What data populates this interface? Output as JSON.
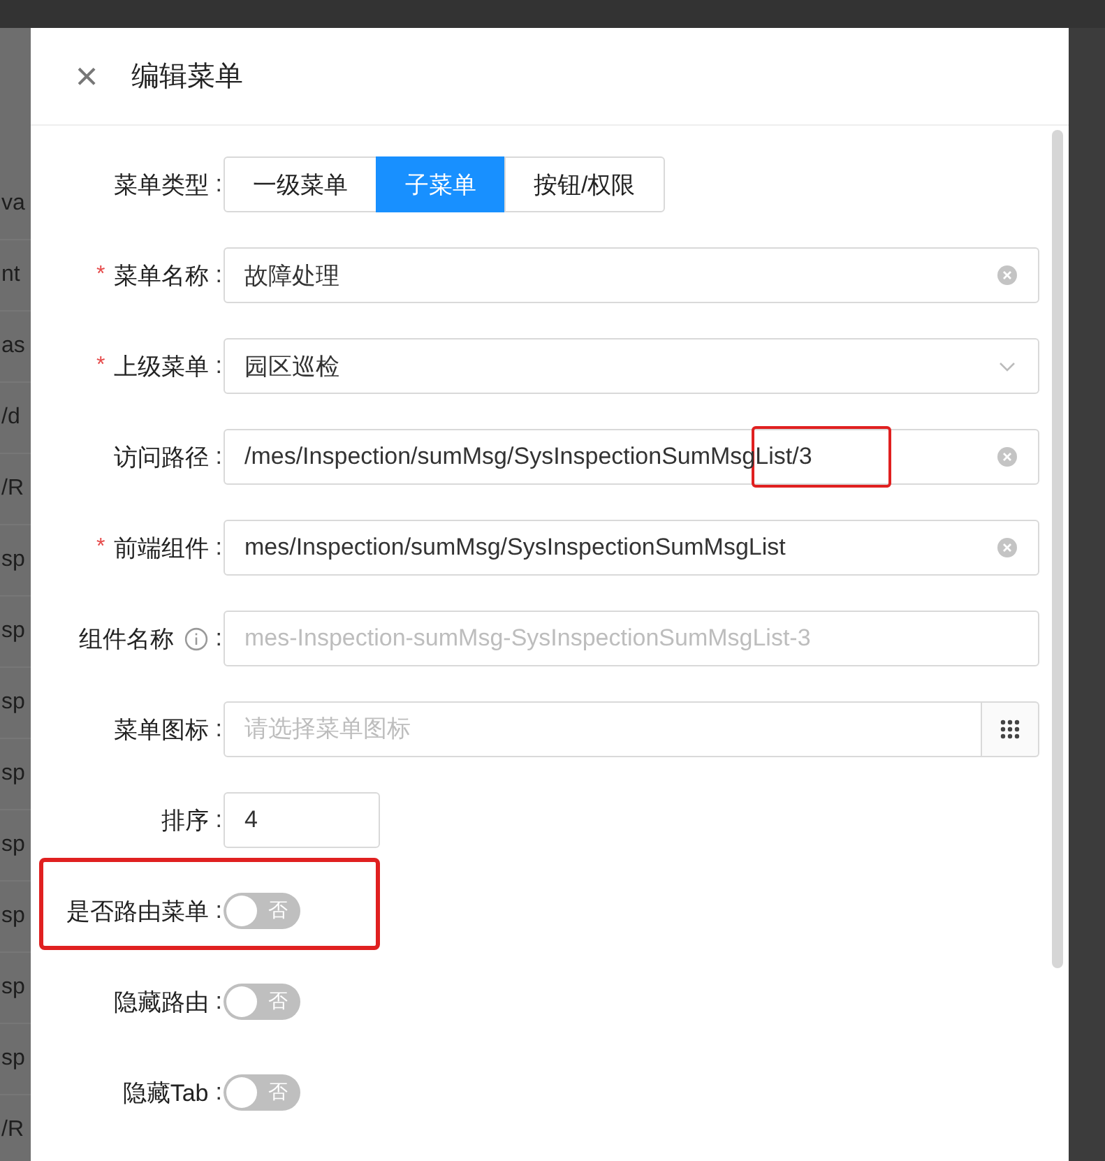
{
  "background_fragments": [
    "va",
    "nt",
    "as",
    "/d",
    "/R",
    "sp",
    "sp",
    "sp",
    "sp",
    "sp",
    "sp",
    "sp",
    "sp",
    "/R"
  ],
  "drawer": {
    "close": "×",
    "title": "编辑菜单"
  },
  "form": [
    {
      "kind": "segmented",
      "label": "菜单类型",
      "colon": ":",
      "options": [
        {
          "label": "一级菜单",
          "selected": false
        },
        {
          "label": "子菜单",
          "selected": true
        },
        {
          "label": "按钮/权限",
          "selected": false
        }
      ]
    },
    {
      "kind": "input",
      "required_mark": "*",
      "label": "菜单名称",
      "colon": ":",
      "value": "故障处理"
    },
    {
      "kind": "select",
      "required_mark": "*",
      "label": "上级菜单",
      "colon": ":",
      "value": "园区巡检"
    },
    {
      "kind": "input",
      "label": "访问路径",
      "colon": ":",
      "value": "/mes/Inspection/sumMsg/SysInspectionSumMsgList/3",
      "marked": true
    },
    {
      "kind": "input",
      "required_mark": "*",
      "label": "前端组件",
      "colon": ":",
      "value": "mes/Inspection/sumMsg/SysInspectionSumMsgList"
    },
    {
      "kind": "hint",
      "label": "组件名称",
      "colon": ":",
      "placeholder": "mes-Inspection-sumMsg-SysInspectionSumMsgList-3"
    },
    {
      "kind": "icon",
      "label": "菜单图标",
      "colon": ":",
      "placeholder": "请选择菜单图标"
    },
    {
      "kind": "number",
      "label": "排序",
      "colon": ":",
      "value": "4"
    },
    {
      "kind": "switch",
      "label": "是否路由菜单",
      "colon": ":",
      "on": false,
      "text": "否",
      "marked": true
    },
    {
      "kind": "switch",
      "label": "隐藏路由",
      "colon": ":",
      "on": false,
      "text": "否"
    },
    {
      "kind": "switch",
      "label": "隐藏Tab",
      "colon": ":",
      "on": false,
      "text": "否"
    }
  ]
}
